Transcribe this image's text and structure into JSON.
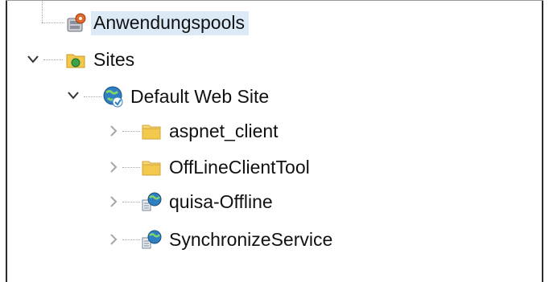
{
  "tree": {
    "items": [
      {
        "label": "Anwendungspools",
        "icon": "application-pools-icon",
        "state": "selected"
      },
      {
        "label": "Sites",
        "icon": "sites-folder-icon",
        "state": "expanded"
      },
      {
        "label": "Default Web Site",
        "icon": "web-site-globe-icon",
        "state": "expanded"
      },
      {
        "label": "aspnet_client",
        "icon": "folder-icon",
        "state": "collapsed"
      },
      {
        "label": "OffLineClientTool",
        "icon": "folder-icon",
        "state": "collapsed"
      },
      {
        "label": "quisa-Offline",
        "icon": "web-application-icon",
        "state": "collapsed"
      },
      {
        "label": "SynchronizeService",
        "icon": "web-application-icon",
        "state": "collapsed"
      }
    ]
  },
  "colors": {
    "selection": "#dce9f6",
    "folder": "#f2c94c",
    "globe": "#2f7fc3",
    "chevron_expanded": "#333333",
    "chevron_collapsed": "#a6a6a6"
  }
}
